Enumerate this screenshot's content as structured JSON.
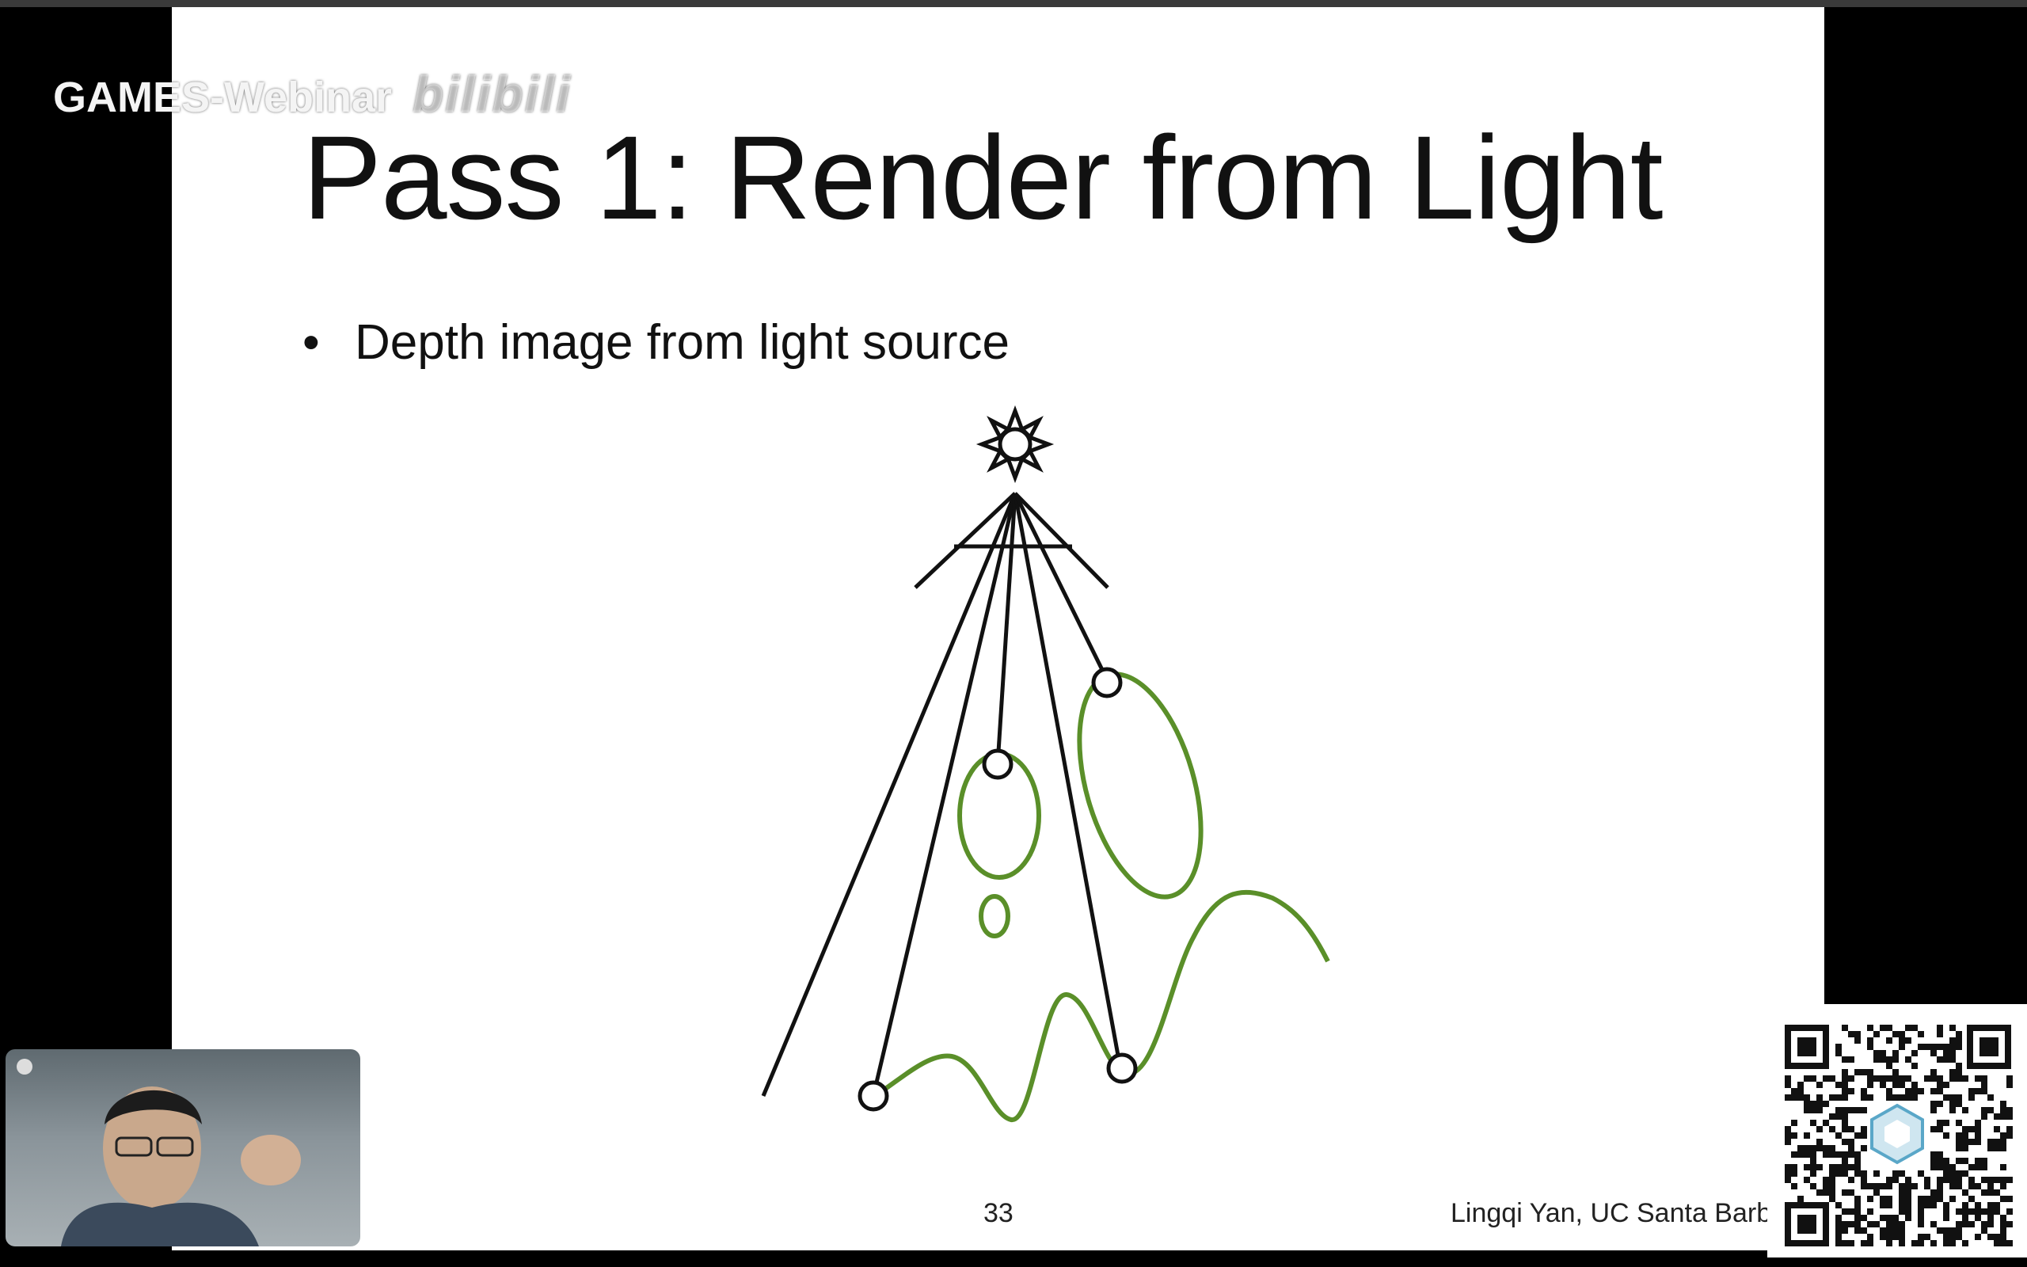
{
  "slide": {
    "title": "Pass 1: Render from Light",
    "bullets": [
      "Depth image from light source"
    ],
    "page_number": "33",
    "credit": "Lingqi Yan, UC Santa Barba"
  },
  "overlay": {
    "watermark_text": "GAMES-Webinar",
    "watermark_logo": "bilibili"
  },
  "colors": {
    "slide_bg": "#ffffff",
    "text": "#111111",
    "object_outline": "#5a8f29",
    "ray": "#111111",
    "background": "#000000"
  },
  "icons": {
    "light": "sun-icon",
    "qr": "qr-code-icon"
  }
}
